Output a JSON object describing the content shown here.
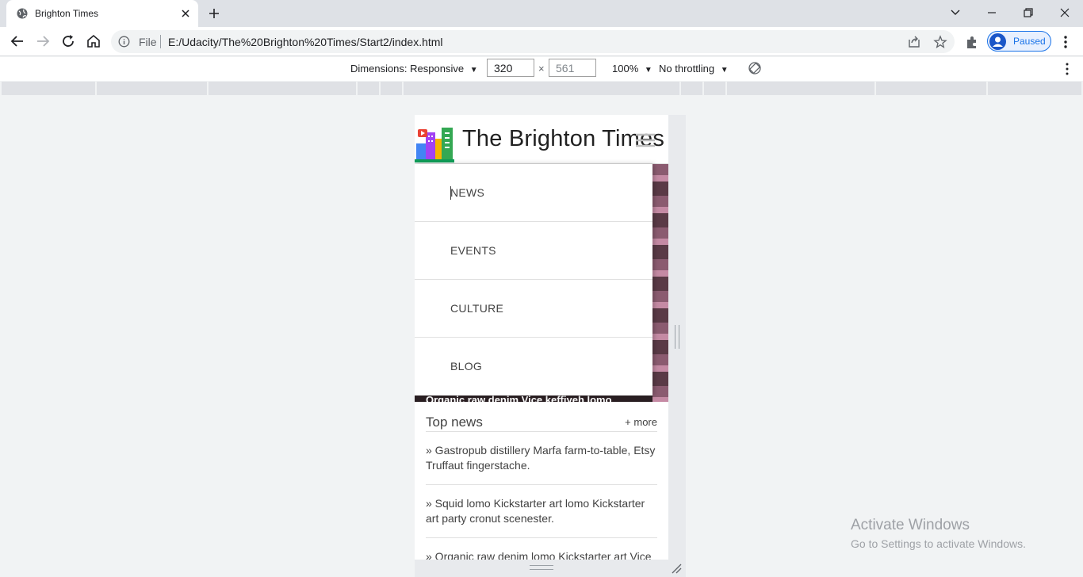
{
  "browser": {
    "tab_title": "Brighton Times",
    "omnibox_scheme": "File",
    "url": "E:/Udacity/The%20Brighton%20Times/Start2/index.html",
    "profile_label": "Paused",
    "icons": [
      "globe-icon",
      "close-icon",
      "plus-icon",
      "back-icon",
      "forward-icon",
      "reload-icon",
      "home-icon",
      "info-icon",
      "share-icon",
      "star-icon",
      "puzzle-icon",
      "kebab-icon",
      "chevron-down-icon",
      "minimize-icon",
      "restore-icon"
    ]
  },
  "devtools": {
    "dimensions_label": "Dimensions: Responsive",
    "width_value": "320",
    "height_value": "561",
    "times_sign": "×",
    "zoom_label": "100%",
    "throttle_label": "No throttling",
    "caret": "▼"
  },
  "site": {
    "title": "The Brighton Times",
    "menu_items": [
      "NEWS",
      "EVENTS",
      "CULTURE",
      "BLOG"
    ],
    "hero_caption": "Organic raw denim Vice keffiyeh lomo",
    "top_news": {
      "heading": "Top news",
      "more_link": "+ more",
      "stories": [
        "» Gastropub distillery Marfa farm-to-table, Etsy Truffaut fingerstache.",
        "» Squid lomo Kickstarter art lomo Kickstarter art party cronut scenester.",
        "» Organic raw denim lomo Kickstarter art Vice"
      ]
    }
  },
  "os_watermark": {
    "line1": "Activate Windows",
    "line2": "Go to Settings to activate Windows."
  }
}
